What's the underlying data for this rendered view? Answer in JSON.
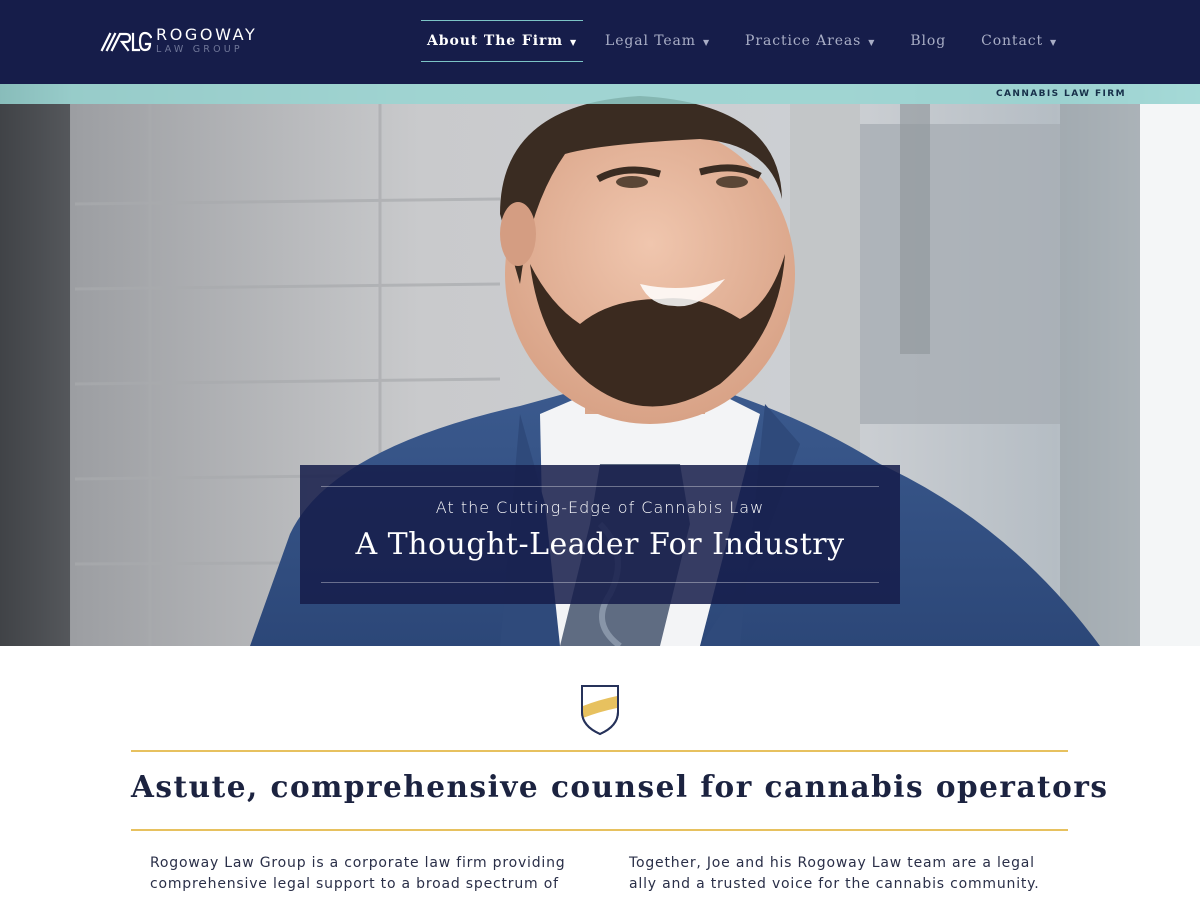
{
  "brand": {
    "mark": "RLG",
    "name": "ROGOWAY",
    "sub": "LAW GROUP"
  },
  "nav": {
    "items": [
      {
        "label": "About The Firm",
        "has_dropdown": true,
        "active": true
      },
      {
        "label": "Legal Team",
        "has_dropdown": true,
        "active": false
      },
      {
        "label": "Practice Areas",
        "has_dropdown": true,
        "active": false
      },
      {
        "label": "Blog",
        "has_dropdown": false,
        "active": false
      },
      {
        "label": "Contact",
        "has_dropdown": true,
        "active": false
      }
    ],
    "caret": "▼"
  },
  "hero": {
    "strip_label": "CANNABIS LAW FIRM",
    "kicker": "At the Cutting-Edge of Cannabis Law",
    "title": "A Thought-Leader For Industry"
  },
  "content": {
    "heading": "Astute, comprehensive counsel for cannabis operators",
    "left_paragraph": "Rogoway Law Group is a corporate law firm providing comprehensive legal support to a broad spectrum of",
    "right_paragraph": "Together, Joe and his Rogoway Law team are a legal ally and a trusted voice for the cannabis community."
  },
  "colors": {
    "navy": "#161d4a",
    "teal": "#96d6d2",
    "gold": "#e7c15f",
    "nav_text": "#a9aec6"
  },
  "icons": {
    "logo": "rlg-monogram-icon",
    "dropdown": "chevron-down-icon",
    "emblem": "shield-icon"
  }
}
